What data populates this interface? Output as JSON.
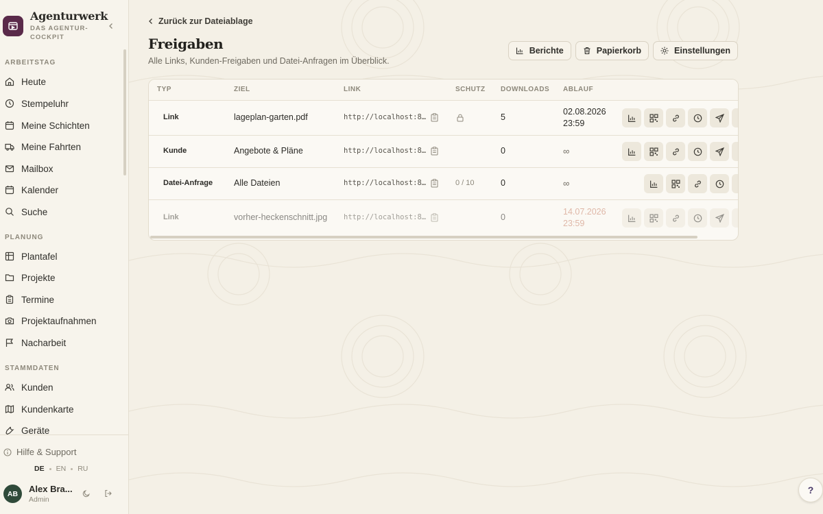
{
  "brand": {
    "name": "Agenturwerk",
    "subtitle": "DAS AGENTUR-COCKPIT"
  },
  "sidebar": {
    "sections": [
      {
        "title": "ARBEITSTAG",
        "items": [
          {
            "label": "Heute",
            "icon": "home-icon"
          },
          {
            "label": "Stempeluhr",
            "icon": "clock-icon"
          },
          {
            "label": "Meine Schichten",
            "icon": "calendar-icon"
          },
          {
            "label": "Meine Fahrten",
            "icon": "truck-icon"
          },
          {
            "label": "Mailbox",
            "icon": "mail-icon"
          },
          {
            "label": "Kalender",
            "icon": "calendar-icon"
          },
          {
            "label": "Suche",
            "icon": "search-icon"
          }
        ]
      },
      {
        "title": "PLANUNG",
        "items": [
          {
            "label": "Plantafel",
            "icon": "board-icon"
          },
          {
            "label": "Projekte",
            "icon": "folder-icon"
          },
          {
            "label": "Termine",
            "icon": "clipboard-icon"
          },
          {
            "label": "Projektaufnahmen",
            "icon": "camera-icon"
          },
          {
            "label": "Nacharbeit",
            "icon": "flag-icon"
          }
        ]
      },
      {
        "title": "STAMMDATEN",
        "items": [
          {
            "label": "Kunden",
            "icon": "users-icon"
          },
          {
            "label": "Kundenkarte",
            "icon": "map-icon"
          },
          {
            "label": "Geräte",
            "icon": "wrench-icon"
          }
        ]
      }
    ],
    "footer": {
      "help": "Hilfe & Support",
      "languages": [
        "DE",
        "EN",
        "RU"
      ],
      "active_language": "DE",
      "user": {
        "initials": "AB",
        "name": "Alex Bra...",
        "role": "Admin"
      }
    }
  },
  "main": {
    "back": "Zurück zur Dateiablage",
    "title": "Freigaben",
    "subtitle": "Alle Links, Kunden-Freigaben und Datei-Anfragen im Überblick.",
    "actions": [
      "Berichte",
      "Papierkorb",
      "Einstellungen"
    ],
    "table": {
      "headers": [
        "TYP",
        "ZIEL",
        "LINK",
        "SCHUTZ",
        "DOWNLOADS",
        "ABLAUF"
      ],
      "rows": [
        {
          "type": "Link",
          "target": "lageplan-garten.pdf",
          "link": "http://localhost:8…",
          "protection": "lock",
          "downloads": "5",
          "expiry": [
            "02.08.2026",
            "23:59"
          ],
          "expired": false,
          "faded": false
        },
        {
          "type": "Kunde",
          "target": "Angebote & Pläne",
          "link": "http://localhost:8…",
          "protection": "",
          "downloads": "0",
          "expiry": [
            "∞"
          ],
          "expired": false,
          "faded": false
        },
        {
          "type": "Datei-Anfrage",
          "target": "Alle Dateien",
          "link": "http://localhost:8…",
          "protection": "0 / 10",
          "downloads": "0",
          "expiry": [
            "∞"
          ],
          "expired": false,
          "faded": false
        },
        {
          "type": "Link",
          "target": "vorher-heckenschnitt.jpg",
          "link": "http://localhost:8…",
          "protection": "",
          "downloads": "0",
          "expiry": [
            "14.07.2026",
            "23:59"
          ],
          "expired": true,
          "faded": true
        }
      ]
    }
  },
  "help_fab": "?",
  "colors": {
    "brand_logo": "#5a2a4a",
    "avatar": "#2f4a3a",
    "expired": "#c9826a"
  }
}
